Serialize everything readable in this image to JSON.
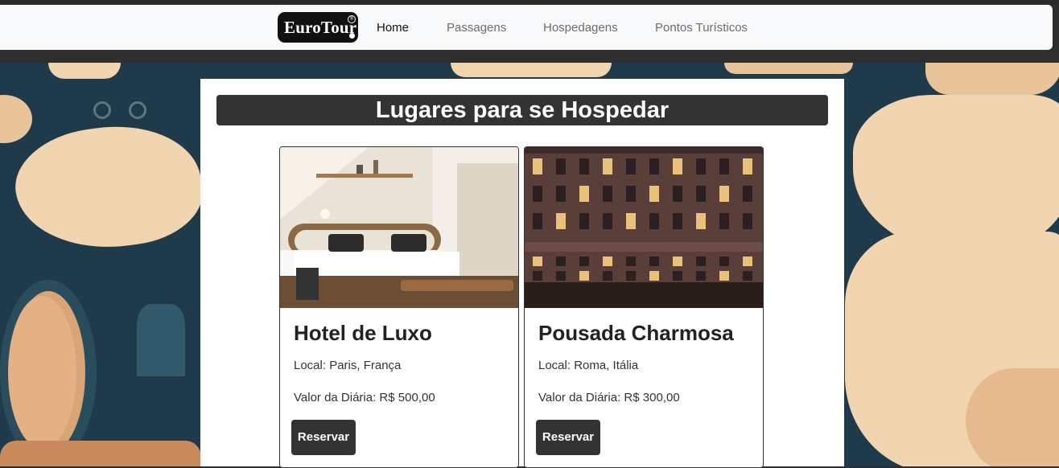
{
  "brand": {
    "name": "EuroTour",
    "reg_mark": "®"
  },
  "nav": {
    "items": [
      {
        "label": "Home",
        "active": true
      },
      {
        "label": "Passagens",
        "active": false
      },
      {
        "label": "Hospedagens",
        "active": false
      },
      {
        "label": "Pontos Turísticos",
        "active": false
      }
    ]
  },
  "main": {
    "title": "Lugares para se Hospedar",
    "cards": [
      {
        "name": "Hotel de Luxo",
        "local": "Local: Paris, França",
        "price": "Valor da Diária: R$ 500,00",
        "button": "Reservar",
        "image": "hotel-room-photo"
      },
      {
        "name": "Pousada Charmosa",
        "local": "Local: Roma, Itália",
        "price": "Valor da Diária: R$ 300,00",
        "button": "Reservar",
        "image": "hotel-facade-photo"
      }
    ]
  },
  "colors": {
    "dark": "#333333",
    "navbar_bg": "#f8f9fa",
    "map_sea": "#1f3a4a",
    "map_land": "#f1d5b1"
  }
}
